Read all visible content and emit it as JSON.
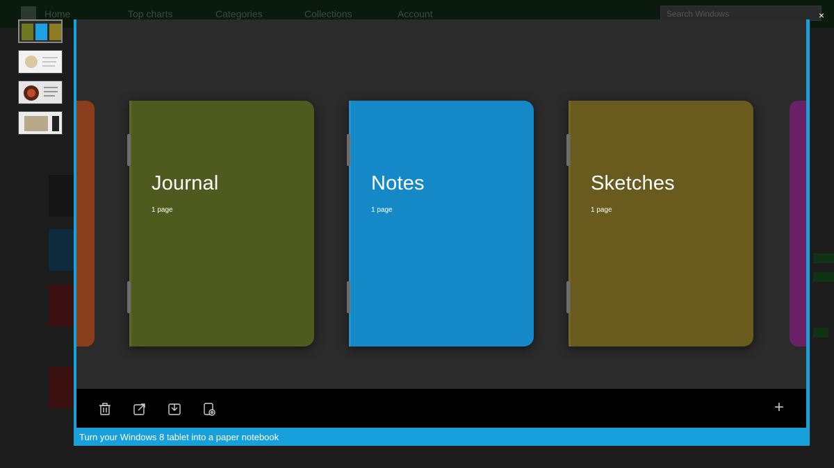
{
  "store": {
    "nav": [
      "Home",
      "Top charts",
      "Categories",
      "Collections",
      "Account"
    ],
    "search_placeholder": "Search Windows"
  },
  "thumbnails": [
    {
      "label": "Notebooks screenshot",
      "selected": true
    },
    {
      "label": "Screenshot 2",
      "selected": false
    },
    {
      "label": "Screenshot 3",
      "selected": false
    },
    {
      "label": "Screenshot 4",
      "selected": false
    }
  ],
  "notebooks": [
    {
      "title": "Journal",
      "pages": "1 page",
      "color": "#4f5a1e"
    },
    {
      "title": "Notes",
      "pages": "1 page",
      "color": "#1589c8"
    },
    {
      "title": "Sketches",
      "pages": "1 page",
      "color": "#685b1d"
    }
  ],
  "edge_notebooks": {
    "left_color": "#8a3e1c",
    "right_color": "#6b2168"
  },
  "appbar": {
    "icons": [
      "trash-icon",
      "share-icon",
      "save-icon",
      "settings-icon",
      "add-icon"
    ],
    "add_label": "+"
  },
  "caption": "Turn your Windows 8 tablet into a paper notebook",
  "close_label": "×",
  "colors": {
    "accent": "#17a0dc",
    "viewer_bg": "#2b2b2b",
    "appbar_bg": "#000000"
  }
}
